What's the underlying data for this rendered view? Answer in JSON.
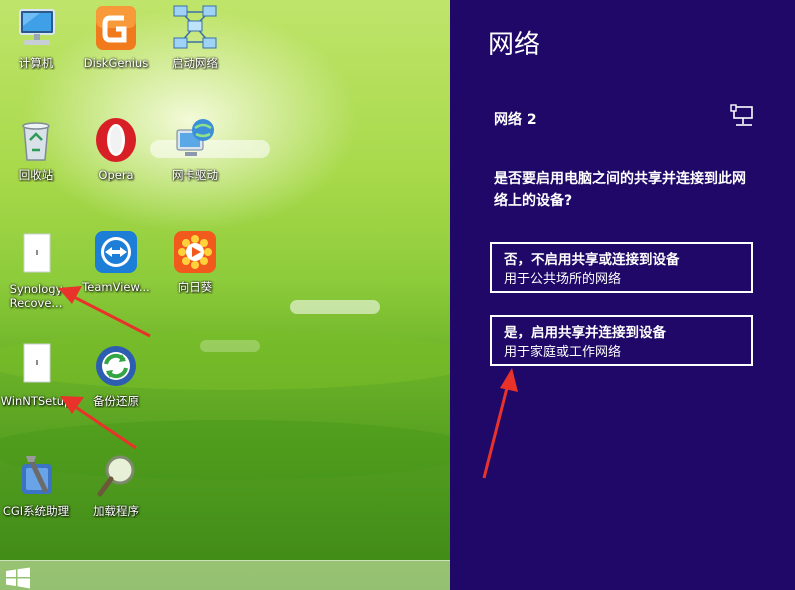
{
  "desktop": {
    "icons": [
      {
        "label": "计算机",
        "icon": "computer-icon"
      },
      {
        "label": "DiskGenius",
        "icon": "diskgenius-icon"
      },
      {
        "label": "启动网络",
        "icon": "network-topology-icon"
      },
      {
        "label": "回收站",
        "icon": "recycle-bin-icon"
      },
      {
        "label": "Opera",
        "icon": "opera-icon"
      },
      {
        "label": "网卡驱动",
        "icon": "network-driver-globe-icon"
      },
      {
        "label": "Synology",
        "label2": "Recove...",
        "icon": "blank-file-icon"
      },
      {
        "label": "TeamView...",
        "icon": "teamviewer-icon"
      },
      {
        "label": "向日葵",
        "icon": "sunflower-icon"
      },
      {
        "label": "WinNTSetup",
        "icon": "blank-file-icon"
      },
      {
        "label": "备份还原",
        "icon": "backup-restore-icon"
      },
      {
        "label": "CGI系统助理",
        "icon": "cgi-tool-icon"
      },
      {
        "label": "加载程序",
        "icon": "magnifier-icon"
      }
    ],
    "colors": {
      "arrow": "#e8322a"
    }
  },
  "taskbar": {
    "start_icon": "windows-logo-icon"
  },
  "network_panel": {
    "title": "网络",
    "network_name": "网络 2",
    "network_icon": "wired-network-icon",
    "question": "是否要启用电脑之间的共享并连接到此网络上的设备?",
    "options": [
      {
        "title": "否，不启用共享或连接到设备",
        "subtitle": "用于公共场所的网络"
      },
      {
        "title": "是，启用共享并连接到设备",
        "subtitle": "用于家庭或工作网络"
      }
    ],
    "colors": {
      "background": "#1f0868",
      "text": "#ffffff"
    }
  }
}
